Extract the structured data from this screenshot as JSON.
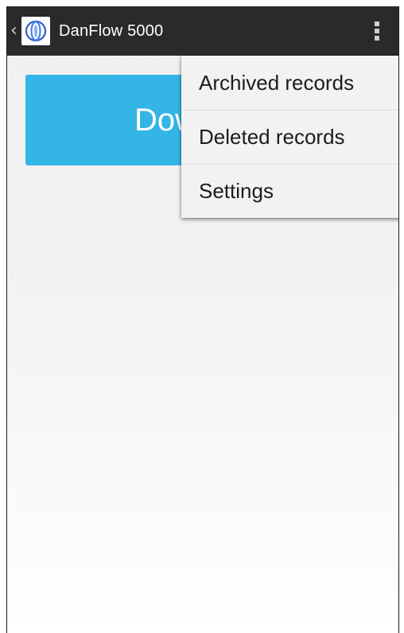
{
  "action_bar": {
    "title": "DanFlow 5000",
    "back_icon": "chevron-left-icon",
    "app_icon": "danflow-logo-icon",
    "overflow_icon": "more-vertical-icon",
    "background_color": "#2a2a2a"
  },
  "main": {
    "download_button_label": "Download",
    "accent_color": "#33b5e5"
  },
  "overflow_menu": {
    "items": [
      {
        "label": "Archived records"
      },
      {
        "label": "Deleted records"
      },
      {
        "label": "Settings"
      }
    ]
  }
}
